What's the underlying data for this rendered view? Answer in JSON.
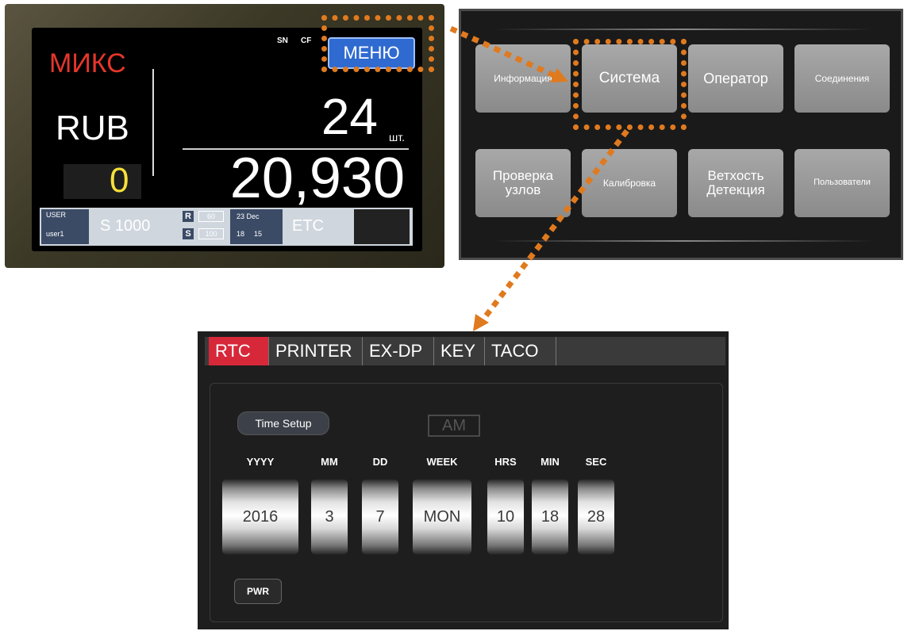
{
  "panel1": {
    "mode": "МИКС",
    "sn": "SN",
    "cf": "CF",
    "menu_button": "МЕНЮ",
    "currency": "RUB",
    "count": "24",
    "count_unit": "шт.",
    "aux_count": "0",
    "total": "20,930",
    "status": {
      "user_label": "USER",
      "user_name": "user1",
      "denom": "S 1000",
      "r": "R",
      "r_value": "60",
      "s": "S",
      "s_value": "100",
      "date": "23 Dec",
      "time_h": "18",
      "time_m": "15",
      "etc": "ETC"
    }
  },
  "panel2": {
    "buttons": [
      "Информация",
      "Система",
      "Оператор",
      "Соединения",
      "Проверка узлов",
      "Калибровка",
      "Ветхость Детекция",
      "Пользователи"
    ]
  },
  "panel3": {
    "tabs": [
      "RTC",
      "PRINTER",
      "EX-DP",
      "KEY",
      "TACO"
    ],
    "time_setup": "Time Setup",
    "am": "AM",
    "labels": [
      "YYYY",
      "MM",
      "DD",
      "WEEK",
      "HRS",
      "MIN",
      "SEC"
    ],
    "values": [
      "2016",
      "3",
      "7",
      "MON",
      "10",
      "18",
      "28"
    ],
    "pwr": "PWR"
  },
  "colors": {
    "highlight": "#e07a1f",
    "active_tab": "#d7283a",
    "menu_button": "#2f6ad0",
    "mode_text": "#e6362b",
    "aux_count": "#f6e03a"
  }
}
